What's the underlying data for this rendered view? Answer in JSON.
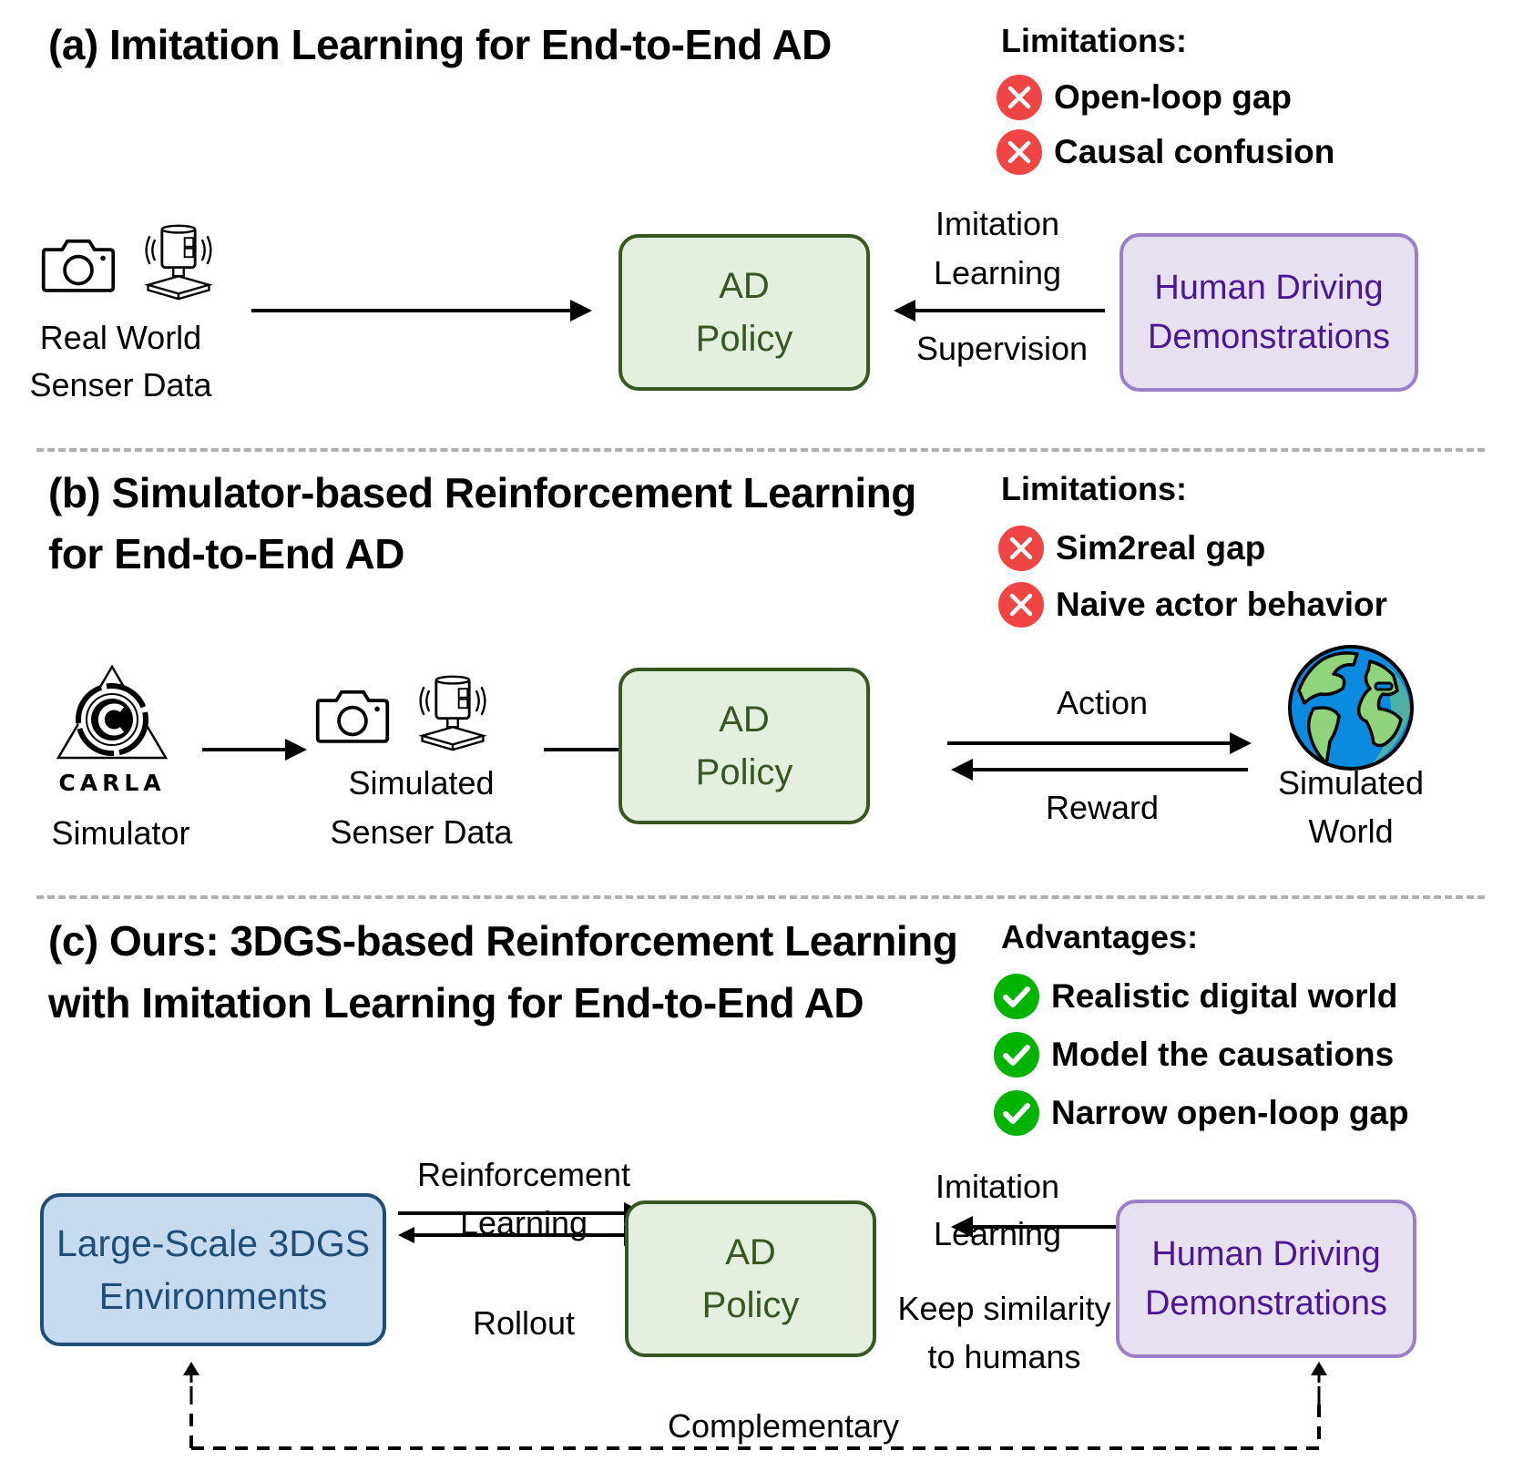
{
  "colors": {
    "policy_fill": "#e4efdd",
    "policy_border": "#385723",
    "human_fill": "#e6e0f0",
    "human_border": "#9b7fc8",
    "human_text": "#4b1796",
    "env_fill": "#c6dbf0",
    "env_border": "#1f4e79",
    "limitation_icon": "#f04545",
    "advantage_icon": "#00b400",
    "divider": "#b0b0b0"
  },
  "panel_a": {
    "title": "(a) Imitation Learning for End-to-End AD",
    "list_heading": "Limitations:",
    "limitations": [
      {
        "icon": "x-circle-icon",
        "text": "Open-loop gap"
      },
      {
        "icon": "x-circle-icon",
        "text": "Causal confusion"
      }
    ],
    "sensor_icons": [
      "camera-icon",
      "lidar-icon"
    ],
    "sensor_label_line1": "Real World",
    "sensor_label_line2": "Senser Data",
    "policy_line1": "AD",
    "policy_line2": "Policy",
    "edge_top_line1": "Imitation",
    "edge_top_line2": "Learning",
    "edge_bottom": "Supervision",
    "human_line1": "Human Driving",
    "human_line2": "Demonstrations"
  },
  "panel_b": {
    "title_line1": "(b) Simulator-based Reinforcement Learning",
    "title_line2": "for End-to-End AD",
    "list_heading": "Limitations:",
    "limitations": [
      {
        "icon": "x-circle-icon",
        "text": "Sim2real gap"
      },
      {
        "icon": "x-circle-icon",
        "text": "Naive actor behavior"
      }
    ],
    "simulator_logo_text": "CARLA",
    "simulator_label": "Simulator",
    "sensor_label_line1": "Simulated",
    "sensor_label_line2": "Senser Data",
    "policy_line1": "AD",
    "policy_line2": "Policy",
    "edge_top": "Action",
    "edge_bottom": "Reward",
    "world_label_line1": "Simulated",
    "world_label_line2": "World"
  },
  "panel_c": {
    "title_line1": "(c) Ours: 3DGS-based Reinforcement Learning",
    "title_line2": "with Imitation Learning for End-to-End AD",
    "list_heading": "Advantages:",
    "advantages": [
      {
        "icon": "check-circle-icon",
        "text": "Realistic digital world"
      },
      {
        "icon": "check-circle-icon",
        "text": "Model the causations"
      },
      {
        "icon": "check-circle-icon",
        "text": "Narrow open-loop gap"
      }
    ],
    "env_line1": "Large-Scale 3DGS",
    "env_line2": "Environments",
    "rl_line1": "Reinforcement",
    "rl_line2": "Learning",
    "rollout": "Rollout",
    "policy_line1": "AD",
    "policy_line2": "Policy",
    "il_line1": "Imitation",
    "il_line2": "Learning",
    "keep_line1": "Keep similarity",
    "keep_line2": "to humans",
    "human_line1": "Human Driving",
    "human_line2": "Demonstrations",
    "complementary": "Complementary"
  }
}
